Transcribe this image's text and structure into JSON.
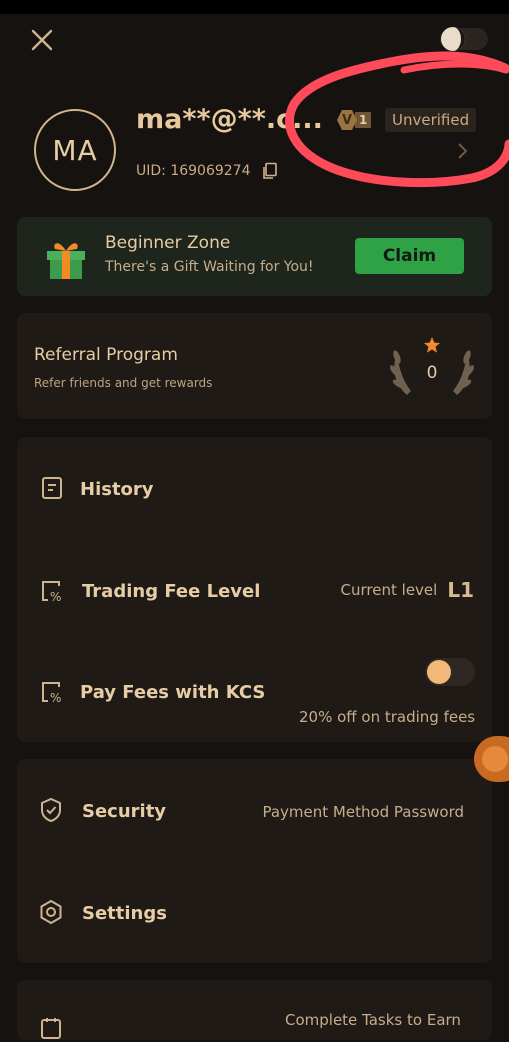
{
  "header": {
    "avatar_initials": "MA",
    "username": "ma**@**.c...",
    "vip_letter": "V",
    "vip_level": "1",
    "verification_status": "Unverified",
    "uid_text": "UID: 169069274"
  },
  "beginner_zone": {
    "title": "Beginner Zone",
    "subtitle": "There's a Gift Waiting for You!",
    "claim_label": "Claim"
  },
  "referral": {
    "title": "Referral Program",
    "subtitle": "Refer friends and get rewards",
    "count": "0"
  },
  "menu": {
    "history_label": "History",
    "trading_fee_label": "Trading Fee Level",
    "current_level_label": "Current level",
    "current_level_value": "L1",
    "pay_fees_label": "Pay Fees with KCS",
    "pay_fees_sub": "20% off on trading fees",
    "pay_fees_enabled": false
  },
  "menu2": {
    "security_label": "Security",
    "security_value": "Payment Method Password",
    "settings_label": "Settings"
  },
  "menu3": {
    "complete_tasks": "Complete Tasks to Earn"
  },
  "colors": {
    "accent_gold": "#d9b98f",
    "claim_green": "#2fa245",
    "annotation_red": "#ff4a5a",
    "toggle_knob": "#f4b77a"
  },
  "icons": [
    "close-icon",
    "theme-toggle-icon",
    "copy-icon",
    "chevron-right-icon",
    "gift-icon",
    "laurel-icon",
    "star-icon",
    "history-icon",
    "percent-doc-icon",
    "shield-check-icon",
    "gear-icon",
    "record-icon"
  ]
}
